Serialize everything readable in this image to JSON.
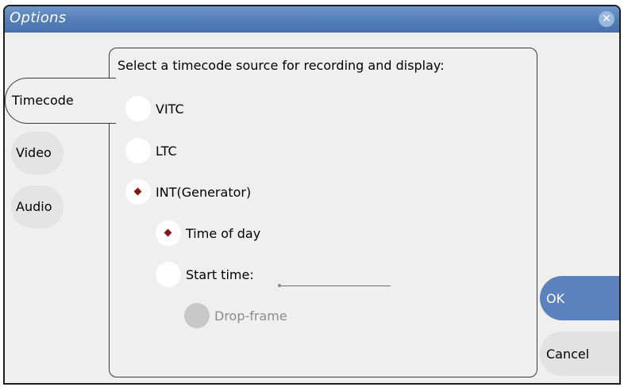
{
  "window": {
    "title": "Options"
  },
  "tabs": [
    {
      "label": "Timecode",
      "active": true
    },
    {
      "label": "Video",
      "active": false
    },
    {
      "label": "Audio",
      "active": false
    }
  ],
  "panel": {
    "heading": "Select a timecode source for recording and display:",
    "source_options": [
      {
        "label": "VITC",
        "checked": false
      },
      {
        "label": "LTC",
        "checked": false
      },
      {
        "label": "INT(Generator)",
        "checked": true
      }
    ],
    "generator_options": [
      {
        "label": "Time of day",
        "checked": true
      },
      {
        "label": "Start time:",
        "checked": false
      }
    ],
    "start_time_value": "",
    "drop_frame": {
      "label": "Drop-frame",
      "checked": false,
      "enabled": false
    }
  },
  "actions": {
    "ok_label": "OK",
    "cancel_label": "Cancel"
  },
  "colors": {
    "title_bar": "#5480b8",
    "ok_button": "#5b82bc",
    "selected_dot": "#8b1414"
  }
}
